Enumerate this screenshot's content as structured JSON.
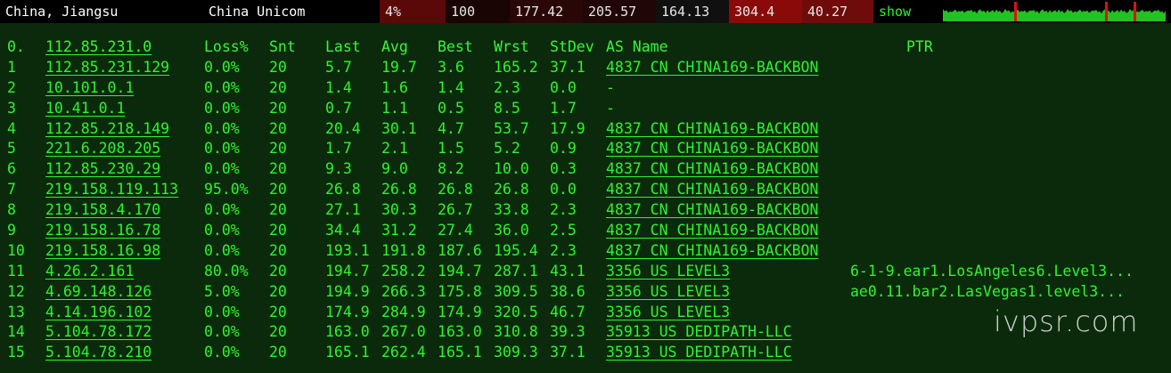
{
  "topbar": {
    "location": "China, Jiangsu",
    "isp": "China Unicom",
    "loss": "4%",
    "sent": "100",
    "last": "177.42",
    "avg": "205.57",
    "best": "164.13",
    "worst": "304.4",
    "stdev": "40.27",
    "show_label": "show",
    "colors": {
      "loss_bg": "#5a0808",
      "sent_bg": "#1a0505",
      "last_bg": "#2a0707",
      "avg_bg": "#200606",
      "best_bg": "#101010",
      "worst_bg": "#8a0a0a",
      "stdev_bg": "#700b0b"
    }
  },
  "headers": [
    "0.",
    "112.85.231.0",
    "Loss%",
    "Snt",
    "Last",
    "Avg",
    "Best",
    "Wrst",
    "StDev",
    "AS Name",
    "PTR"
  ],
  "rows": [
    {
      "n": "1",
      "ip": "112.85.231.129",
      "loss": "0.0%",
      "snt": "20",
      "last": "5.7",
      "avg": "19.7",
      "best": "3.6",
      "wrst": "165.2",
      "stdev": "37.1",
      "as": "4837  CN CHINA169-BACKBON",
      "ptr": ""
    },
    {
      "n": "2",
      "ip": "10.101.0.1",
      "loss": "0.0%",
      "snt": "20",
      "last": "1.4",
      "avg": "1.6",
      "best": "1.4",
      "wrst": "2.3",
      "stdev": "0.0",
      "as": "-",
      "ptr": ""
    },
    {
      "n": "3",
      "ip": "10.41.0.1",
      "loss": "0.0%",
      "snt": "20",
      "last": "0.7",
      "avg": "1.1",
      "best": "0.5",
      "wrst": "8.5",
      "stdev": "1.7",
      "as": "-",
      "ptr": ""
    },
    {
      "n": "4",
      "ip": "112.85.218.149",
      "loss": "0.0%",
      "snt": "20",
      "last": "20.4",
      "avg": "30.1",
      "best": "4.7",
      "wrst": "53.7",
      "stdev": "17.9",
      "as": "4837  CN CHINA169-BACKBON",
      "ptr": ""
    },
    {
      "n": "5",
      "ip": "221.6.208.205",
      "loss": "0.0%",
      "snt": "20",
      "last": "1.7",
      "avg": "2.1",
      "best": "1.5",
      "wrst": "5.2",
      "stdev": "0.9",
      "as": "4837  CN CHINA169-BACKBON",
      "ptr": ""
    },
    {
      "n": "6",
      "ip": "112.85.230.29",
      "loss": "0.0%",
      "snt": "20",
      "last": "9.3",
      "avg": "9.0",
      "best": "8.2",
      "wrst": "10.0",
      "stdev": "0.3",
      "as": "4837  CN CHINA169-BACKBON",
      "ptr": ""
    },
    {
      "n": "7",
      "ip": "219.158.119.113",
      "loss": "95.0%",
      "snt": "20",
      "last": "26.8",
      "avg": "26.8",
      "best": "26.8",
      "wrst": "26.8",
      "stdev": "0.0",
      "as": "4837  CN CHINA169-BACKBON",
      "ptr": ""
    },
    {
      "n": "8",
      "ip": "219.158.4.170",
      "loss": "0.0%",
      "snt": "20",
      "last": "27.1",
      "avg": "30.3",
      "best": "26.7",
      "wrst": "33.8",
      "stdev": "2.3",
      "as": "4837  CN CHINA169-BACKBON",
      "ptr": ""
    },
    {
      "n": "9",
      "ip": "219.158.16.78",
      "loss": "0.0%",
      "snt": "20",
      "last": "34.4",
      "avg": "31.2",
      "best": "27.4",
      "wrst": "36.0",
      "stdev": "2.5",
      "as": "4837  CN CHINA169-BACKBON",
      "ptr": ""
    },
    {
      "n": "10",
      "ip": "219.158.16.98",
      "loss": "0.0%",
      "snt": "20",
      "last": "193.1",
      "avg": "191.8",
      "best": "187.6",
      "wrst": "195.4",
      "stdev": "2.3",
      "as": "4837  CN CHINA169-BACKBON",
      "ptr": ""
    },
    {
      "n": "11",
      "ip": "4.26.2.161",
      "loss": "80.0%",
      "snt": "20",
      "last": "194.7",
      "avg": "258.2",
      "best": "194.7",
      "wrst": "287.1",
      "stdev": "43.1",
      "as": "3356  US LEVEL3",
      "ptr": "6-1-9.ear1.LosAngeles6.Level3..."
    },
    {
      "n": "12",
      "ip": "4.69.148.126",
      "loss": "5.0%",
      "snt": "20",
      "last": "194.9",
      "avg": "266.3",
      "best": "175.8",
      "wrst": "309.5",
      "stdev": "38.6",
      "as": "3356  US LEVEL3",
      "ptr": "ae0.11.bar2.LasVegas1.level3..."
    },
    {
      "n": "13",
      "ip": "4.14.196.102",
      "loss": "0.0%",
      "snt": "20",
      "last": "174.9",
      "avg": "284.9",
      "best": "174.9",
      "wrst": "320.5",
      "stdev": "46.7",
      "as": "3356  US LEVEL3",
      "ptr": ""
    },
    {
      "n": "14",
      "ip": "5.104.78.172",
      "loss": "0.0%",
      "snt": "20",
      "last": "163.0",
      "avg": "267.0",
      "best": "163.0",
      "wrst": "310.8",
      "stdev": "39.3",
      "as": "35913 US DEDIPATH-LLC",
      "ptr": ""
    },
    {
      "n": "15",
      "ip": "5.104.78.210",
      "loss": "0.0%",
      "snt": "20",
      "last": "165.1",
      "avg": "262.4",
      "best": "165.1",
      "wrst": "309.3",
      "stdev": "37.1",
      "as": "35913 US DEDIPATH-LLC",
      "ptr": ""
    }
  ],
  "watermark": "ivpsr.com"
}
